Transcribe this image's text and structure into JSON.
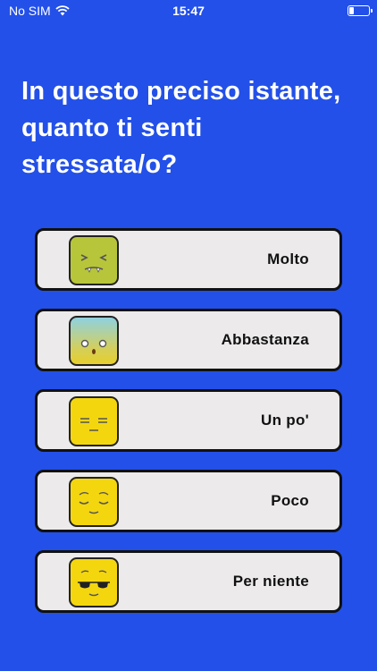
{
  "status_bar": {
    "carrier": "No SIM",
    "time": "15:47",
    "battery_level": 0.25
  },
  "question": {
    "text": "In questo preciso istante, quanto ti senti stressata/o?"
  },
  "options": [
    {
      "label": "Molto",
      "icon": "nauseated-face-icon",
      "color": "#b7c53a"
    },
    {
      "label": "Abbastanza",
      "icon": "worried-face-icon",
      "color": "#8fd1d8"
    },
    {
      "label": "Un po'",
      "icon": "expressionless-face-icon",
      "color": "#f4d60f"
    },
    {
      "label": "Poco",
      "icon": "relieved-face-icon",
      "color": "#f4d60f"
    },
    {
      "label": "Per niente",
      "icon": "cool-face-icon",
      "color": "#f4d60f"
    }
  ],
  "colors": {
    "background": "#2350e8",
    "card": "#eceaea",
    "border": "#111111"
  }
}
